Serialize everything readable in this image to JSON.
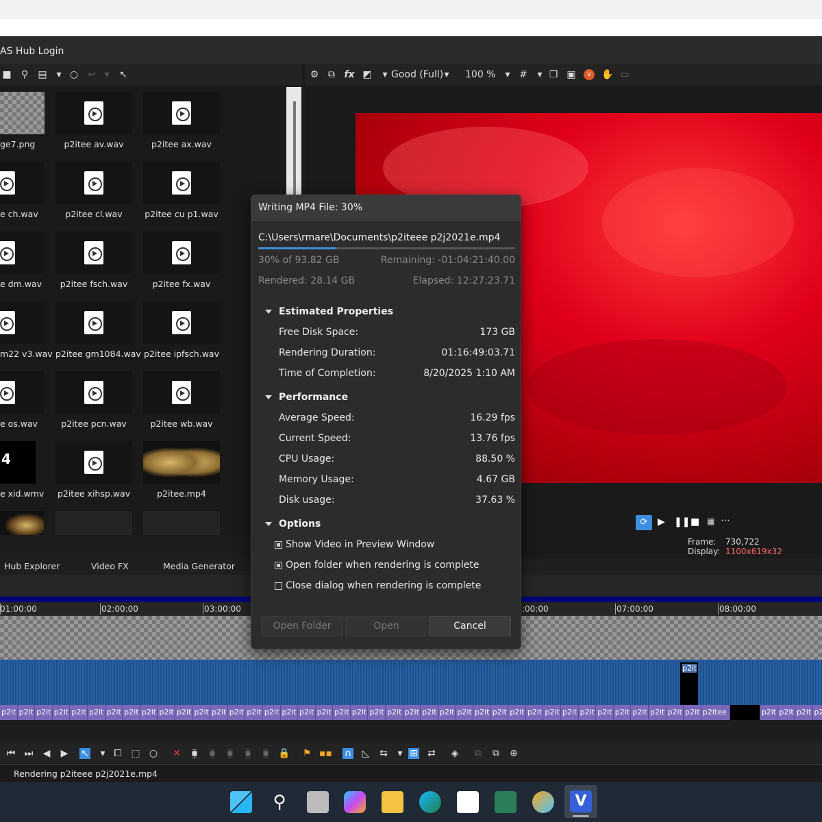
{
  "window": {
    "title_fragment": "AS Hub Login"
  },
  "preview_toolbar": {
    "quality": "Good (Full)",
    "zoom": "100 %"
  },
  "media_files": [
    {
      "label": "ge7.png"
    },
    {
      "label": "p2itee av.wav"
    },
    {
      "label": "p2itee ax.wav"
    },
    {
      "label": "e ch.wav"
    },
    {
      "label": "p2itee cl.wav"
    },
    {
      "label": "p2itee cu p1.wav"
    },
    {
      "label": "e dm.wav"
    },
    {
      "label": "p2itee fsch.wav"
    },
    {
      "label": "p2itee fx.wav"
    },
    {
      "label": "m22 v3.wav"
    },
    {
      "label": "p2itee gm1084.wav"
    },
    {
      "label": "p2itee ipfsch.wav"
    },
    {
      "label": "e os.wav"
    },
    {
      "label": "p2itee pcn.wav"
    },
    {
      "label": "p2itee wb.wav"
    },
    {
      "label": "e xid.wmv"
    },
    {
      "label": "p2itee xihsp.wav"
    },
    {
      "label": "p2itee.mp4"
    }
  ],
  "tabs": {
    "hub_explorer": "Hub Explorer",
    "video_fx": "Video FX",
    "media_generator": "Media Generator"
  },
  "frame_info": {
    "frame_label": "Frame:",
    "frame_value": "730,722",
    "display_label": "Display:",
    "display_value": "1100x619x32"
  },
  "ruler": {
    "t1": "01:00:00",
    "t2": "02:00:00",
    "t3": "03:00:00",
    "t6": ":00:00",
    "t7": "07:00:00",
    "t8": "08:00:00"
  },
  "timeline": {
    "event_label": "p2it",
    "event_label_long": "p2itee"
  },
  "status": {
    "text": "Rendering p2iteee p2j2021e.mp4"
  },
  "dialog": {
    "title": "Writing MP4 File: 30%",
    "path": "C:\\Users\\rmare\\Documents\\p2iteee p2j2021e.mp4",
    "progress": 0.3,
    "percent_of": "30% of 93.82 GB",
    "remaining": "Remaining: -01:04:21:40.00",
    "rendered": "Rendered: 28.14 GB",
    "elapsed": "Elapsed: 12:27:23.71",
    "estimated": {
      "heading": "Estimated Properties",
      "free_disk_label": "Free Disk Space:",
      "free_disk_value": "173 GB",
      "duration_label": "Rendering Duration:",
      "duration_value": "01:16:49:03.71",
      "completion_label": "Time of Completion:",
      "completion_value": "8/20/2025 1:10 AM"
    },
    "performance": {
      "heading": "Performance",
      "avg_label": "Average Speed:",
      "avg_value": "16.29 fps",
      "cur_label": "Current Speed:",
      "cur_value": "13.76 fps",
      "cpu_label": "CPU Usage:",
      "cpu_value": "88.50 %",
      "mem_label": "Memory Usage:",
      "mem_value": "4.67 GB",
      "disk_label": "Disk usage:",
      "disk_value": "37.63 %"
    },
    "options": {
      "heading": "Options",
      "show_video": "Show Video in Preview Window",
      "open_folder": "Open folder when rendering is complete",
      "close_dialog": "Close dialog when rendering is complete"
    },
    "buttons": {
      "open_folder": "Open Folder",
      "open": "Open",
      "cancel": "Cancel"
    }
  },
  "colors": {
    "accent": "#3d8fe0",
    "preview_red": "#e0001a",
    "display_value": "#ff6b6b"
  }
}
